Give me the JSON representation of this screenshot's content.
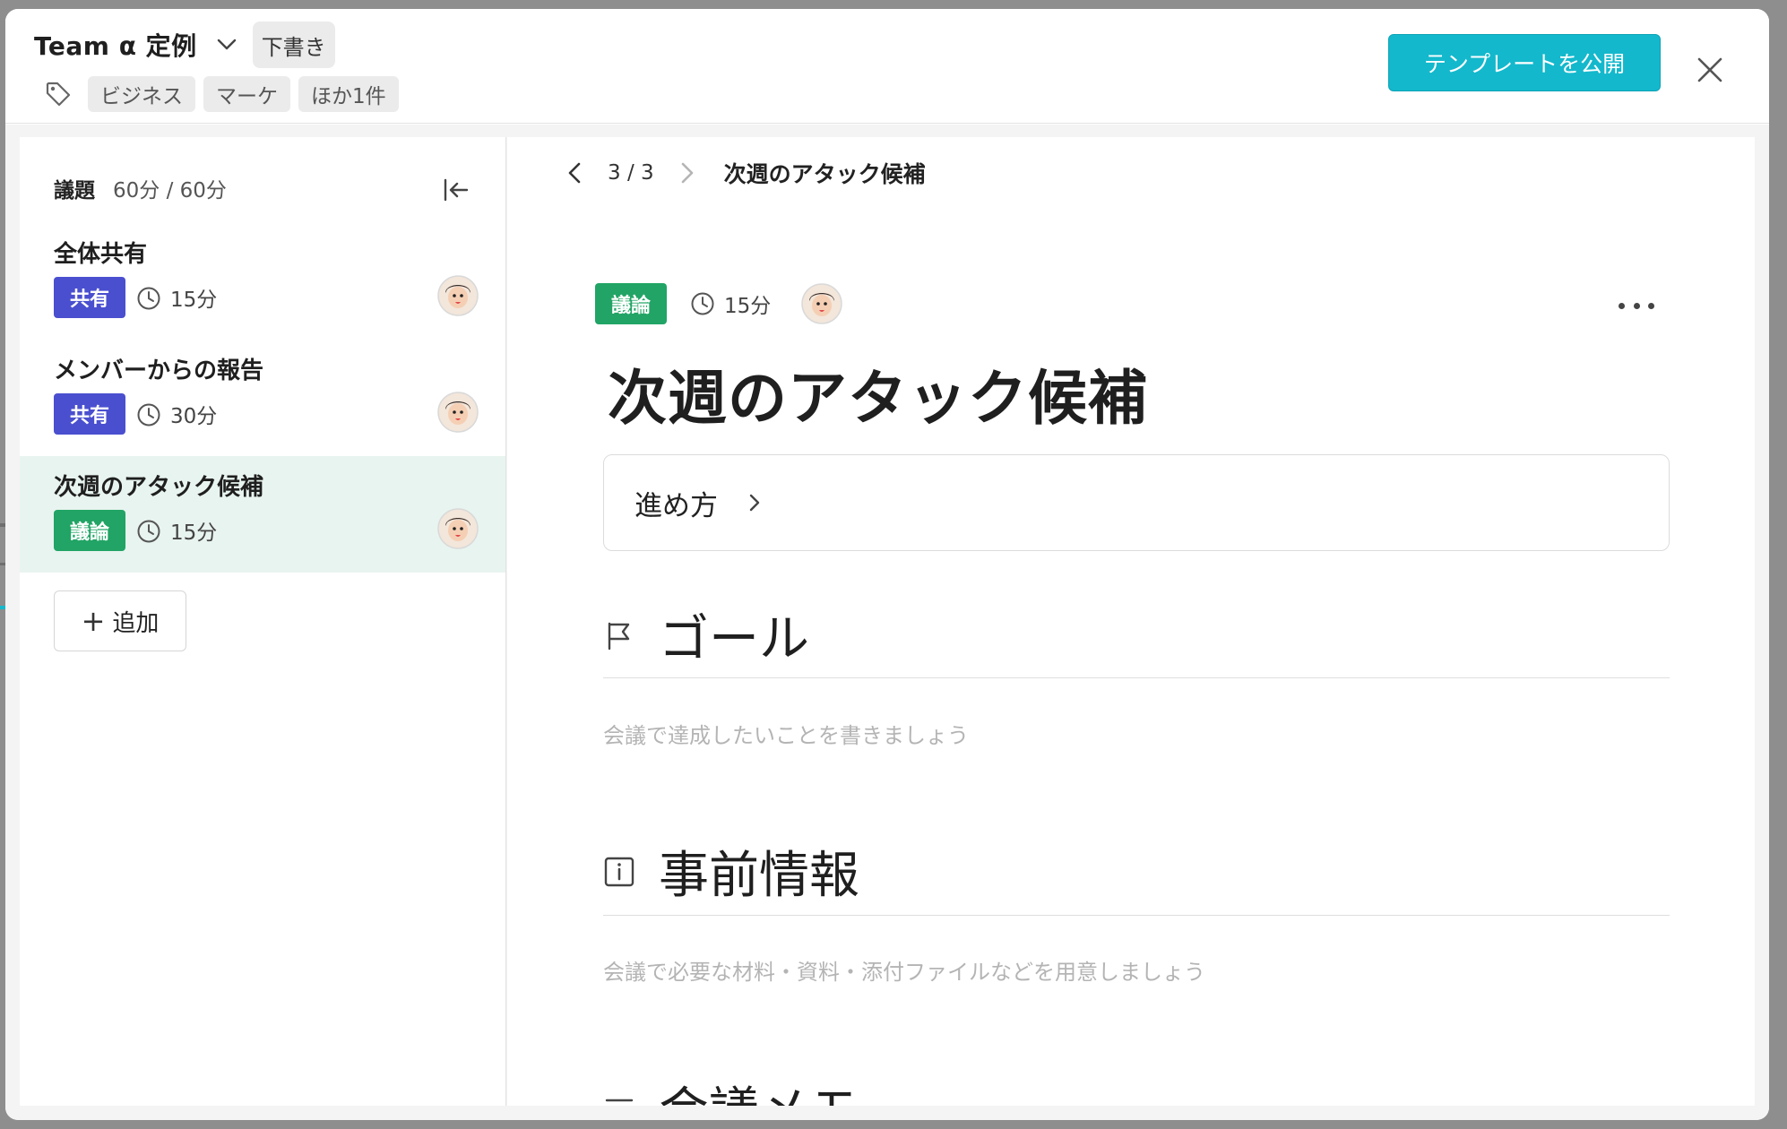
{
  "header": {
    "title": "Team α 定例",
    "status_badge": "下書き",
    "tags": [
      "ビジネス",
      "マーケ",
      "ほか1件"
    ],
    "publish_label": "テンプレートを公開"
  },
  "sidebar": {
    "title": "議題",
    "time_summary": "60分 / 60分",
    "items": [
      {
        "title": "全体共有",
        "type": "共有",
        "type_color": "#4a4fcf",
        "duration": "15分",
        "active": false
      },
      {
        "title": "メンバーからの報告",
        "type": "共有",
        "type_color": "#4a4fcf",
        "duration": "30分",
        "active": false
      },
      {
        "title": "次週のアタック候補",
        "type": "議論",
        "type_color": "#21a465",
        "duration": "15分",
        "active": true
      }
    ],
    "add_label": "追加"
  },
  "main": {
    "nav": {
      "count": "3 / 3",
      "title": "次週のアタック候補"
    },
    "meta": {
      "type": "議論",
      "duration": "15分"
    },
    "heading": "次週のアタック候補",
    "procedure_label": "進め方",
    "sections": [
      {
        "icon": "flag-icon",
        "title": "ゴール",
        "placeholder": "会議で達成したいことを書きましょう"
      },
      {
        "icon": "info-icon",
        "title": "事前情報",
        "placeholder": "会議で必要な材料・資料・添付ファイルなどを用意しましょう"
      },
      {
        "icon": "notes-icon",
        "title": "会議メモ",
        "placeholder": ""
      }
    ]
  }
}
